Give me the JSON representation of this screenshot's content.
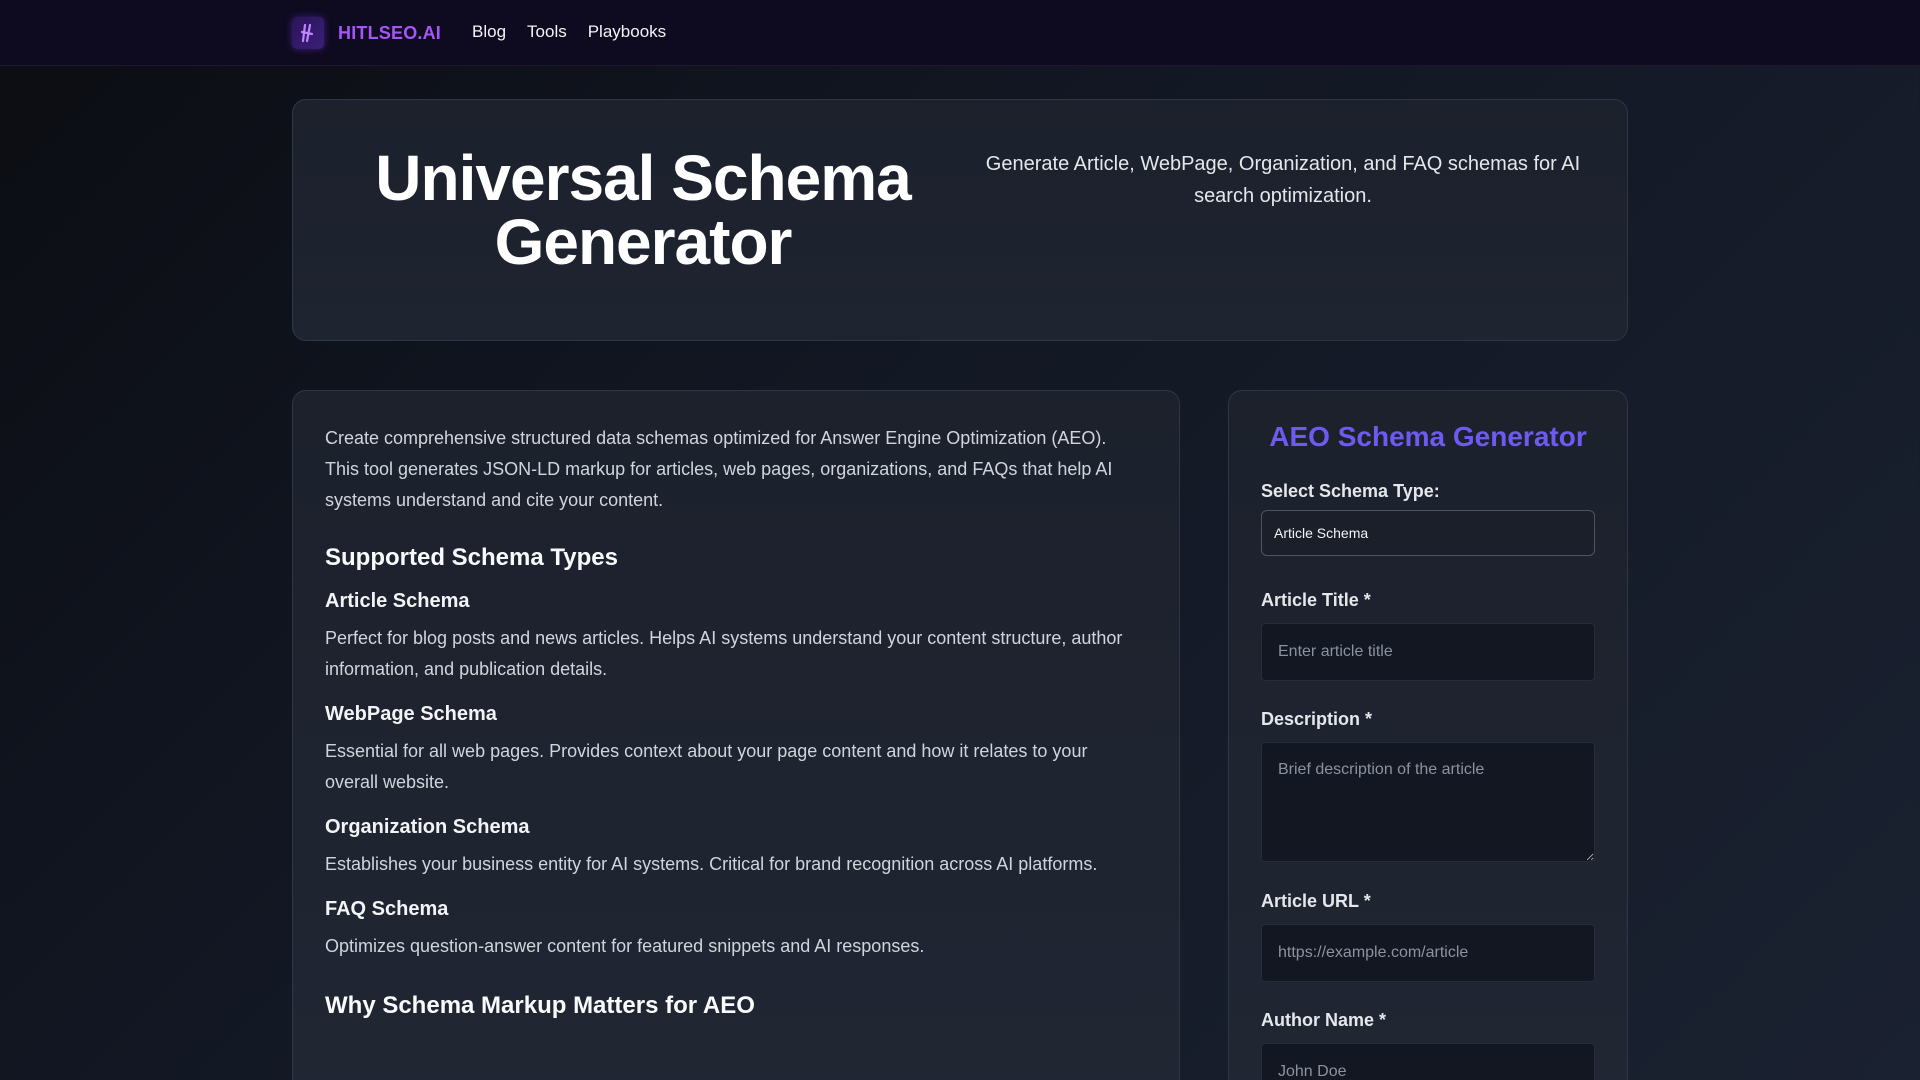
{
  "nav": {
    "brand": "HITLSEO.AI",
    "links": [
      "Blog",
      "Tools",
      "Playbooks"
    ]
  },
  "hero": {
    "title": "Universal Schema Generator",
    "description": "Generate Article, WebPage, Organization, and FAQ schemas for AI search optimization."
  },
  "content": {
    "intro": "Create comprehensive structured data schemas optimized for Answer Engine Optimization (AEO). This tool generates JSON-LD markup for articles, web pages, organizations, and FAQs that help AI systems understand and cite your content.",
    "supported_heading": "Supported Schema Types",
    "types": [
      {
        "title": "Article Schema",
        "desc": "Perfect for blog posts and news articles. Helps AI systems understand your content structure, author information, and publication details."
      },
      {
        "title": "WebPage Schema",
        "desc": "Essential for all web pages. Provides context about your page content and how it relates to your overall website."
      },
      {
        "title": "Organization Schema",
        "desc": "Establishes your business entity for AI systems. Critical for brand recognition across AI platforms."
      },
      {
        "title": "FAQ Schema",
        "desc": "Optimizes question-answer content for featured snippets and AI responses."
      }
    ],
    "why_heading": "Why Schema Markup Matters for AEO"
  },
  "form": {
    "title": "AEO Schema Generator",
    "schema_type_label": "Select Schema Type:",
    "schema_type_value": "Article Schema",
    "fields": {
      "title_label": "Article Title *",
      "title_placeholder": "Enter article title",
      "description_label": "Description *",
      "description_placeholder": "Brief description of the article",
      "url_label": "Article URL *",
      "url_placeholder": "https://example.com/article",
      "author_label": "Author Name *",
      "author_placeholder": "John Doe"
    }
  },
  "colors": {
    "brand": "#a855f7",
    "form_title": "#6d5bf0",
    "nav_bg": "#0e0a1f"
  },
  "icons": {
    "logo": "lightning-logo-icon"
  }
}
